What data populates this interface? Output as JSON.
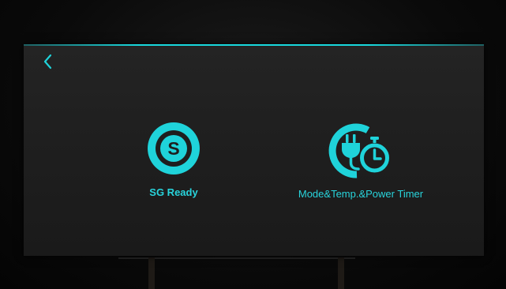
{
  "accent_color": "#1fd3da",
  "header": {
    "back_icon": "chevron-left-icon"
  },
  "tiles": [
    {
      "label": "SG Ready",
      "icon": "sg-ready-icon"
    },
    {
      "label": "Mode&Temp.&Power Timer",
      "icon": "power-timer-icon"
    }
  ]
}
